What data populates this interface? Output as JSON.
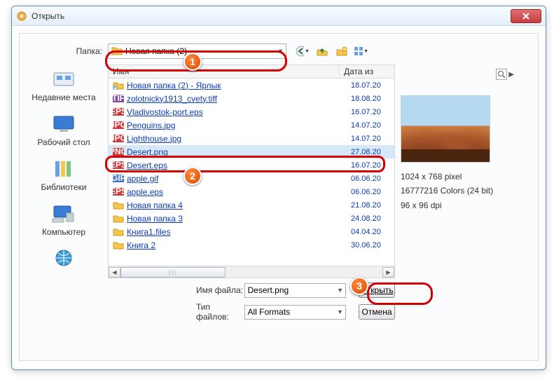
{
  "window": {
    "title": "Открыть"
  },
  "toprow": {
    "label": "Папка:",
    "folder_name": "Новая папка (2)"
  },
  "columns": {
    "name": "Имя",
    "date": "Дата из"
  },
  "files": [
    {
      "icon": "folder-shortcut",
      "name": "Новая папка (2) - Ярлык",
      "date": "18.07.20"
    },
    {
      "icon": "tif",
      "name": "zolotnicky1913_cvety.tiff",
      "date": "18.08.20"
    },
    {
      "icon": "eps",
      "name": "Vladivostok-port.eps",
      "date": "16.07.20"
    },
    {
      "icon": "jpg",
      "name": "Penguins.jpg",
      "date": "14.07.20"
    },
    {
      "icon": "jpg",
      "name": "Lighthouse.jpg",
      "date": "14.07.20"
    },
    {
      "icon": "png",
      "name": "Desert.png",
      "date": "27.08.20",
      "selected": true
    },
    {
      "icon": "eps",
      "name": "Desert.eps",
      "date": "16.07.20"
    },
    {
      "icon": "gif",
      "name": "apple.gif",
      "date": "06.06.20"
    },
    {
      "icon": "eps",
      "name": "apple.eps",
      "date": "06.06.20"
    },
    {
      "icon": "folder",
      "name": "Новая папка 4",
      "date": "21.08.20"
    },
    {
      "icon": "folder",
      "name": "Новая папка 3",
      "date": "24.08.20"
    },
    {
      "icon": "folder",
      "name": "Книга1.files",
      "date": "04.04.20"
    },
    {
      "icon": "folder",
      "name": "Книга 2",
      "date": "30.06.20"
    }
  ],
  "places": [
    {
      "key": "recent",
      "label": "Недавние места"
    },
    {
      "key": "desktop",
      "label": "Рабочий стол"
    },
    {
      "key": "libraries",
      "label": "Библиотеки"
    },
    {
      "key": "computer",
      "label": "Компьютер"
    },
    {
      "key": "network",
      "label": ""
    }
  ],
  "preview": {
    "dimensions": "1024 x 768 pixel",
    "colors": "16777216 Colors (24 bit)",
    "dpi": "96 x 96 dpi"
  },
  "bottom": {
    "filename_label": "Имя файла:",
    "filename_value": "Desert.png",
    "filter_label": "Тип файлов:",
    "filter_value": "All Formats",
    "open_label": "Открыть",
    "cancel_label": "Отмена"
  },
  "icon_colors": {
    "folder": "#f6c746",
    "tif": "#7e4aa3",
    "eps": "#d03a3a",
    "jpg": "#d03a3a",
    "png": "#d03a3a",
    "gif": "#3a74d0"
  }
}
